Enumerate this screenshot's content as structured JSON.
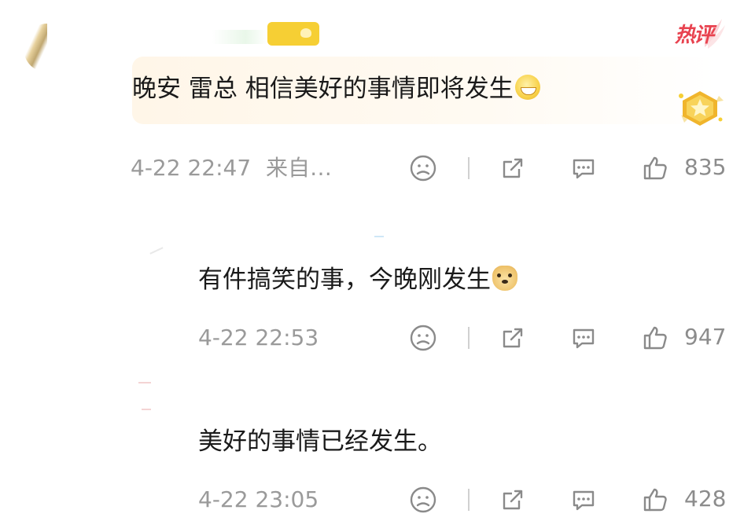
{
  "hot_label": "热评",
  "comments": [
    {
      "text": "晚安 雷总 相信美好的事情即将发生",
      "emoji": "grin-emoji",
      "time": "4-22 22:47",
      "source": "来自…",
      "likes": "835"
    },
    {
      "text": "有件搞笑的事，今晚刚发生",
      "emoji": "doge-emoji",
      "time": "4-22 22:53",
      "likes": "947"
    },
    {
      "text": "美好的事情已经发生。",
      "time": "4-22 23:05",
      "likes": "428"
    }
  ],
  "icons": [
    "dislike-face-icon",
    "share-icon",
    "comment-icon",
    "thumbs-up-icon"
  ],
  "colors": {
    "hot_red": "#e8424f",
    "highlight_bg": "#fff6e8",
    "meta_gray": "#9a9a9a",
    "vip_gold": "#f6cf34"
  }
}
